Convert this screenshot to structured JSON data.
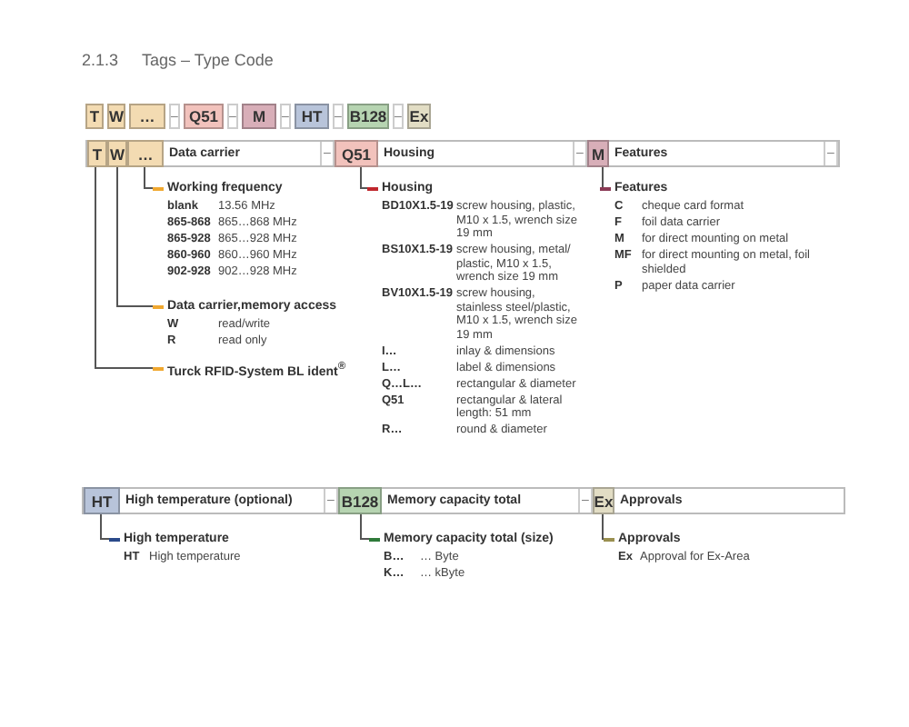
{
  "section": {
    "number": "2.1.3",
    "title": "Tags – Type Code"
  },
  "rows": [
    {
      "segments": [
        {
          "kind": "code",
          "text": "T",
          "color": "#f3dbb2"
        },
        {
          "kind": "code",
          "text": "W",
          "color": "#f3dbb2"
        },
        {
          "kind": "code",
          "text": "…",
          "color": "#f3dbb2"
        },
        {
          "kind": "separator",
          "text": "–"
        },
        {
          "kind": "code",
          "text": "Q51",
          "color": "#f2c2bc"
        },
        {
          "kind": "separator",
          "text": "–"
        },
        {
          "kind": "code",
          "text": "M",
          "color": "#d8aeb8"
        },
        {
          "kind": "separator",
          "text": "–"
        },
        {
          "kind": "code",
          "text": "HT",
          "color": "#b8c4da"
        },
        {
          "kind": "separator",
          "text": "–"
        },
        {
          "kind": "code",
          "text": "B128",
          "color": "#b6d4b1"
        },
        {
          "kind": "separator",
          "text": "–"
        },
        {
          "kind": "code",
          "text": "Ex",
          "color": "#e2ddc4"
        }
      ],
      "legends": []
    },
    {
      "segments": [
        {
          "kind": "code",
          "text": "T",
          "color": "#f3dbb2"
        },
        {
          "kind": "code",
          "text": "W",
          "color": "#f3dbb2"
        },
        {
          "kind": "code",
          "text": "…",
          "color": "#f3dbb2"
        },
        {
          "kind": "label",
          "text": "Data carrier"
        },
        {
          "kind": "separator",
          "text": "–"
        },
        {
          "kind": "code",
          "text": "Q51",
          "color": "#f2c2bc"
        },
        {
          "kind": "label",
          "text": "Housing"
        },
        {
          "kind": "separator",
          "text": "–"
        },
        {
          "kind": "code",
          "text": "M",
          "color": "#d8aeb8"
        },
        {
          "kind": "label",
          "text": "Features"
        },
        {
          "kind": "separator",
          "text": "–"
        }
      ],
      "legends": [
        {
          "title": "Working frequency",
          "color": "#f0a830",
          "entries": [
            {
              "code": "blank",
              "description": "13.56 MHz"
            },
            {
              "code": "865-868",
              "description": "865…868 MHz"
            },
            {
              "code": "865-928",
              "description": "865…928 MHz"
            },
            {
              "code": "860-960",
              "description": "860…960 MHz"
            },
            {
              "code": "902-928",
              "description": "902…928 MHz"
            }
          ]
        },
        {
          "title": "Data carrier,memory access",
          "color": "#f0a830",
          "entries": [
            {
              "code": "W",
              "description": "read/write"
            },
            {
              "code": "R",
              "description": "read only"
            }
          ]
        },
        {
          "title": "Turck RFID-System BL ident$^{®}$",
          "color": "#f0a830"
        },
        {
          "title": "Housing",
          "color": "#c0272d",
          "entries": [
            {
              "code": "BD10X1.5-19",
              "description": "screw housing, plastic, M10 x 1.5, wrench size 19 mm"
            },
            {
              "code": "BS10X1.5-19",
              "description": "screw housing, metal/ plastic, M10 x 1.5, wrench size 19 mm"
            },
            {
              "code": "BV10X1.5-19",
              "description": "screw housing, stainless steel/plastic, M10 x 1.5, wrench size 19 mm"
            },
            {
              "code": "I…",
              "description": "inlay & dimensions"
            },
            {
              "code": "L…",
              "description": "label & dimensions"
            },
            {
              "code": "Q…L…",
              "description": "rectangular & diameter"
            },
            {
              "code": "Q51",
              "description": "rectangular & lateral length: 51 mm"
            },
            {
              "code": "R…",
              "description": "round & diameter"
            }
          ]
        },
        {
          "title": "Features",
          "color": "#8a3a55",
          "entries": [
            {
              "code": "C",
              "description": "cheque card format"
            },
            {
              "code": "F",
              "description": "foil data carrier"
            },
            {
              "code": "M",
              "description": "for direct mounting on metal"
            },
            {
              "code": "MF",
              "description": "for direct mounting on metal, foil shielded"
            },
            {
              "code": "P",
              "description": "paper data carrier"
            }
          ]
        }
      ]
    },
    {
      "segments": [
        {
          "kind": "code",
          "text": "HT",
          "color": "#b8c4da"
        },
        {
          "kind": "label",
          "text": "High temperature (optional)"
        },
        {
          "kind": "separator",
          "text": "–"
        },
        {
          "kind": "code",
          "text": "B128",
          "color": "#b6d4b1"
        },
        {
          "kind": "label",
          "text": "Memory capacity total"
        },
        {
          "kind": "separator",
          "text": "–"
        },
        {
          "kind": "code",
          "text": "Ex",
          "color": "#e2ddc4"
        },
        {
          "kind": "label",
          "text": "Approvals"
        }
      ],
      "legends": [
        {
          "title": "High temperature",
          "color": "#2a4a8a",
          "entries": [
            {
              "code": "HT",
              "description": "High temperature"
            }
          ]
        },
        {
          "title": "Memory capacity total (size)",
          "color": "#2e7a3a",
          "entries": [
            {
              "code": "B…",
              "description": "… Byte"
            },
            {
              "code": "K…",
              "description": "… kByte"
            }
          ]
        },
        {
          "title": "Approvals",
          "color": "#9a9050",
          "entries": [
            {
              "code": "Ex",
              "description": "Approval for Ex-Area"
            }
          ]
        }
      ]
    }
  ]
}
